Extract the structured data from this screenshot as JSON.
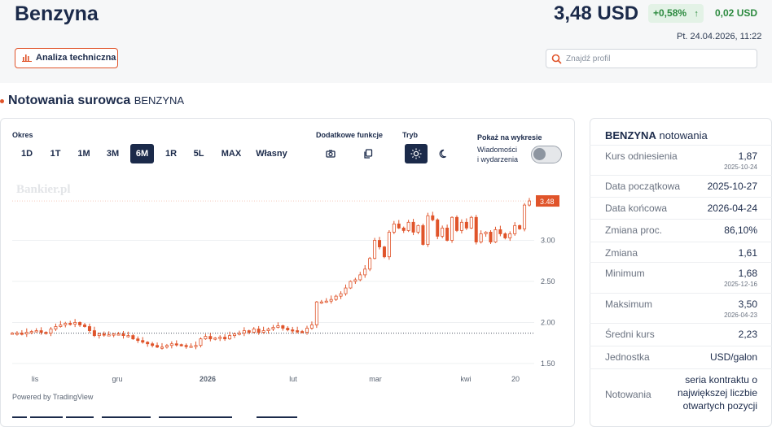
{
  "header": {
    "title": "Benzyna",
    "price": "3,48 USD",
    "change_pct": "+0,58%",
    "change_abs": "0,02 USD",
    "datetime": "Pt. 24.04.2026, 11:22",
    "ta_button": "Analiza techniczna",
    "search_placeholder": "Znajdź profil",
    "colors": {
      "up": "#2c8a3f",
      "accent": "#e0542a",
      "navy": "#1b2a4a"
    }
  },
  "section": {
    "title": "Notowania surowca",
    "subtitle": "BENZYNA"
  },
  "controls": {
    "okres_label": "Okres",
    "periods": [
      "1D",
      "1T",
      "1M",
      "3M",
      "6M",
      "1R",
      "5L",
      "MAX",
      "Własny"
    ],
    "active_period": "6M",
    "extra_label": "Dodatkowe funkcje",
    "mode_label": "Tryb",
    "show_label": "Pokaż na wykresie",
    "news_line1": "Wiadomości",
    "news_line2": "i wydarzenia",
    "icons": [
      "camera-icon",
      "copy-icon",
      "sun-icon",
      "moon-icon"
    ]
  },
  "chart_meta": {
    "watermark": "Bankier.pl",
    "powered": "Powered by TradingView"
  },
  "chart_data": {
    "type": "candlestick",
    "y_ticks": [
      "3.00",
      "2.50",
      "2.00",
      "1.50"
    ],
    "y_tick_values": [
      3.0,
      2.5,
      2.0,
      1.5
    ],
    "ylim": [
      1.43,
      3.55
    ],
    "x_labels": [
      "lis",
      "gru",
      "2026",
      "lut",
      "mar",
      "kwi",
      "20"
    ],
    "last_price": 3.48,
    "last_label": "3.48",
    "reference": 1.87,
    "grid": true,
    "up_color": "#e0542a",
    "down_color": "#e0542a",
    "closes": [
      1.87,
      1.87,
      1.86,
      1.88,
      1.89,
      1.9,
      1.88,
      1.87,
      1.92,
      1.95,
      1.97,
      1.99,
      1.98,
      2.0,
      1.97,
      1.95,
      1.9,
      1.84,
      1.86,
      1.85,
      1.85,
      1.86,
      1.86,
      1.84,
      1.84,
      1.8,
      1.78,
      1.76,
      1.74,
      1.72,
      1.7,
      1.7,
      1.72,
      1.74,
      1.73,
      1.72,
      1.71,
      1.71,
      1.72,
      1.8,
      1.83,
      1.8,
      1.81,
      1.82,
      1.8,
      1.84,
      1.86,
      1.87,
      1.9,
      1.88,
      1.92,
      1.88,
      1.9,
      1.92,
      1.94,
      1.96,
      1.93,
      1.91,
      1.9,
      1.89,
      1.88,
      1.93,
      1.97,
      2.25,
      2.25,
      2.26,
      2.28,
      2.32,
      2.35,
      2.42,
      2.5,
      2.52,
      2.58,
      2.65,
      2.78,
      3.0,
      2.92,
      2.8,
      3.1,
      3.2,
      3.15,
      3.12,
      3.22,
      3.1,
      3.18,
      2.95,
      3.3,
      3.25,
      3.05,
      3.15,
      3.0,
      3.28,
      3.12,
      3.22,
      3.15,
      3.28,
      2.98,
      3.08,
      3.1,
      2.98,
      3.13,
      3.08,
      3.03,
      3.08,
      3.18,
      3.14,
      3.43,
      3.48
    ]
  },
  "stats": {
    "title_bold": "BENZYNA",
    "title_rest": "notowania",
    "rows": [
      {
        "k": "Kurs odniesienia",
        "v": "1,87",
        "d": "2025-10-24"
      },
      {
        "k": "Data początkowa",
        "v": "2025-10-27",
        "d": ""
      },
      {
        "k": "Data końcowa",
        "v": "2026-04-24",
        "d": ""
      },
      {
        "k": "Zmiana proc.",
        "v": "86,10%",
        "d": ""
      },
      {
        "k": "Zmiana",
        "v": "1,61",
        "d": ""
      },
      {
        "k": "Minimum",
        "v": "1,68",
        "d": "2025-12-16"
      },
      {
        "k": "Maksimum",
        "v": "3,50",
        "d": "2026-04-23"
      },
      {
        "k": "Średni kurs",
        "v": "2,23",
        "d": ""
      },
      {
        "k": "Jednostka",
        "v": "USD/galon",
        "d": ""
      },
      {
        "k": "Notowania",
        "v1": "seria kontraktu o",
        "v2": "największej liczbie",
        "v3": "otwartych pozycji"
      }
    ]
  }
}
